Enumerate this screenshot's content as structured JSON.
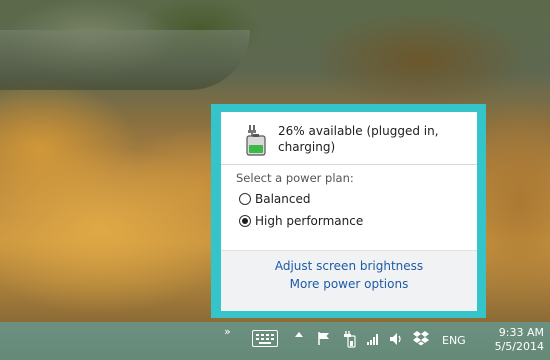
{
  "battery_flyout": {
    "status_text": "26% available (plugged in, charging)",
    "plan_heading": "Select a power plan:",
    "plans": [
      {
        "label": "Balanced",
        "selected": false
      },
      {
        "label": "High performance",
        "selected": true
      }
    ],
    "links": {
      "brightness": "Adjust screen brightness",
      "more_options": "More power options"
    },
    "accent_color": "#36c4cb"
  },
  "taskbar": {
    "show_hidden_label": "»",
    "language": "ENG",
    "time": "9:33 AM",
    "date": "5/5/2014",
    "icons": [
      "touch-keyboard-icon",
      "chevron-up-icon",
      "action-center-flag-icon",
      "power-icon",
      "network-signal-icon",
      "volume-icon",
      "dropbox-icon"
    ],
    "color": "#6d9181"
  }
}
